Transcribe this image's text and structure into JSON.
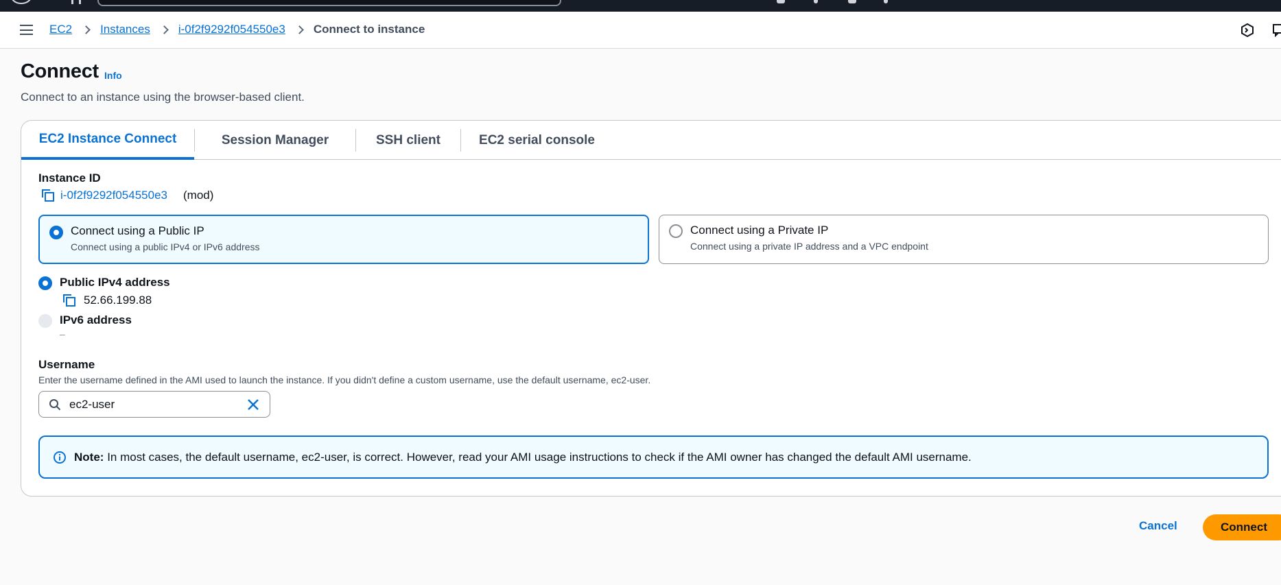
{
  "breadcrumb": {
    "items": [
      "EC2",
      "Instances",
      "i-0f2f9292f054550e3"
    ],
    "current": "Connect to instance"
  },
  "header": {
    "title": "Connect",
    "info_label": "Info",
    "description": "Connect to an instance using the browser-based client."
  },
  "tabs": [
    {
      "label": "EC2 Instance Connect",
      "active": true
    },
    {
      "label": "Session Manager",
      "active": false
    },
    {
      "label": "SSH client",
      "active": false
    },
    {
      "label": "EC2 serial console",
      "active": false
    }
  ],
  "instance": {
    "label": "Instance ID",
    "id": "i-0f2f9292f054550e3",
    "suffix": "(mod)"
  },
  "connection_type": {
    "options": [
      {
        "title": "Connect using a Public IP",
        "subtitle": "Connect using a public IPv4 or IPv6 address",
        "selected": true
      },
      {
        "title": "Connect using a Private IP",
        "subtitle": "Connect using a private IP address and a VPC endpoint",
        "selected": false
      }
    ]
  },
  "address": {
    "ipv4_label": "Public IPv4 address",
    "ipv4_value": "52.66.199.88",
    "ipv6_label": "IPv6 address",
    "ipv6_value": "–"
  },
  "username": {
    "label": "Username",
    "hint": "Enter the username defined in the AMI used to launch the instance. If you didn't define a custom username, use the default username, ec2-user.",
    "value": "ec2-user"
  },
  "note": {
    "prefix": "Note:",
    "text": "In most cases, the default username, ec2-user, is correct. However, read your AMI usage instructions to check if the AMI owner has changed the default AMI username."
  },
  "actions": {
    "cancel": "Cancel",
    "connect": "Connect"
  },
  "colors": {
    "link": "#0972d3",
    "primary_button": "#ff9900",
    "top_nav": "#161d26",
    "selected_card_bg": "#f0fbff"
  },
  "icons": [
    "menu-icon",
    "copy-icon",
    "search-icon",
    "clear-icon",
    "info-circle-icon",
    "cloudshell-icon",
    "feedback-icon"
  ]
}
